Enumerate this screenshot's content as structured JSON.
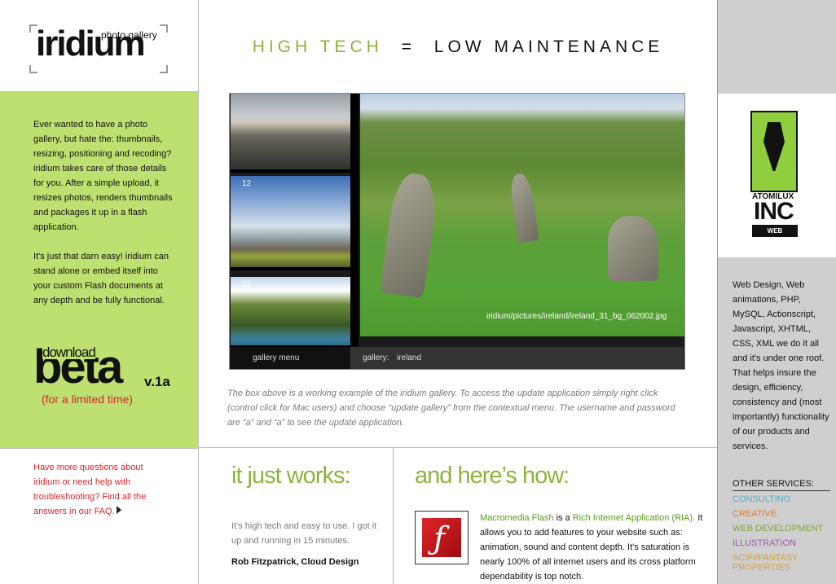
{
  "logo": {
    "wordmark": "iridium",
    "sub": "photo gallery"
  },
  "intro": {
    "paragraph1": "Ever wanted to have a photo gallery, but hate the: thumbnails, resizing, positioning and recoding? iridium takes care of those details for you. After a simple upload, it resizes photos, renders thumbnails and packages it up in a flash application.",
    "paragraph2": "It's just that darn easy! iridium can stand alone or embed itself into your custom Flash documents at any depth and be fully functional."
  },
  "download": {
    "small": "download",
    "big": "beta",
    "version": "v.1a",
    "limited": "(for a limited time)"
  },
  "faq": {
    "text": "Have more questions about iridium or need help with troubleshooting? Find all the answers in our FAQ."
  },
  "headline": {
    "part1": "HIGH TECH",
    "equals": "=",
    "part2": "LOW MAINTENANCE"
  },
  "gallery": {
    "thumb_numbers": [
      "12",
      "13"
    ],
    "caption": "iridium/pictures/ireland/ireland_31_bg_062002.jpg",
    "menu_label": "gallery menu",
    "gallery_label": "gallery:",
    "gallery_value": "ireland"
  },
  "description": "The box above is a working example of the iridium gallery. To access the update application simply right click (control click for Mac users) and choose “update gallery” from the contextual menu. The username and password are “a” and “a” to see the update application.",
  "works": {
    "heading": "it just works:",
    "quote": "It's high tech and easy to use. I got it up and running in 15 minutes.",
    "author": "Rob Fitzpatrick, Cloud Design"
  },
  "how": {
    "heading": "and here’s how:",
    "link1": "Macromedia Flash",
    "mid": " is a ",
    "link2": "Rich Internet Application (RIA).",
    "body": "It allows you to add features to your website such as: animation, sound and content depth. It's saturation is nearly 100% of all internet users and its cross platform dependability is top notch."
  },
  "sponsor": {
    "name": "ATOMILUX",
    "inc": "INC",
    "web": "WEB"
  },
  "services": {
    "text": "Web Design, Web animations, PHP, MySQL, Actionscript, Javascript, XHTML, CSS, XML we do it all and it's under one roof. That helps insure the design, efficiency, consistency and (most importantly) functionality of our products and services.",
    "other_heading": "OTHER SERVICES:",
    "items": [
      {
        "label": "CONSULTING",
        "color": "#5fa8c6"
      },
      {
        "label": "CREATIVE",
        "color": "#e27a2a"
      },
      {
        "label": "WEB DEVELOPMENT",
        "color": "#7ea642"
      },
      {
        "label": "ILLUSTRATION",
        "color": "#9b5ba9"
      },
      {
        "label": "SCIFI/FANTASY PROPERTIES",
        "color": "#d7a23a"
      }
    ]
  },
  "colors": {
    "accent_green": "#8db43a",
    "panel_green": "#bde070",
    "alert_red": "#d8262a"
  }
}
